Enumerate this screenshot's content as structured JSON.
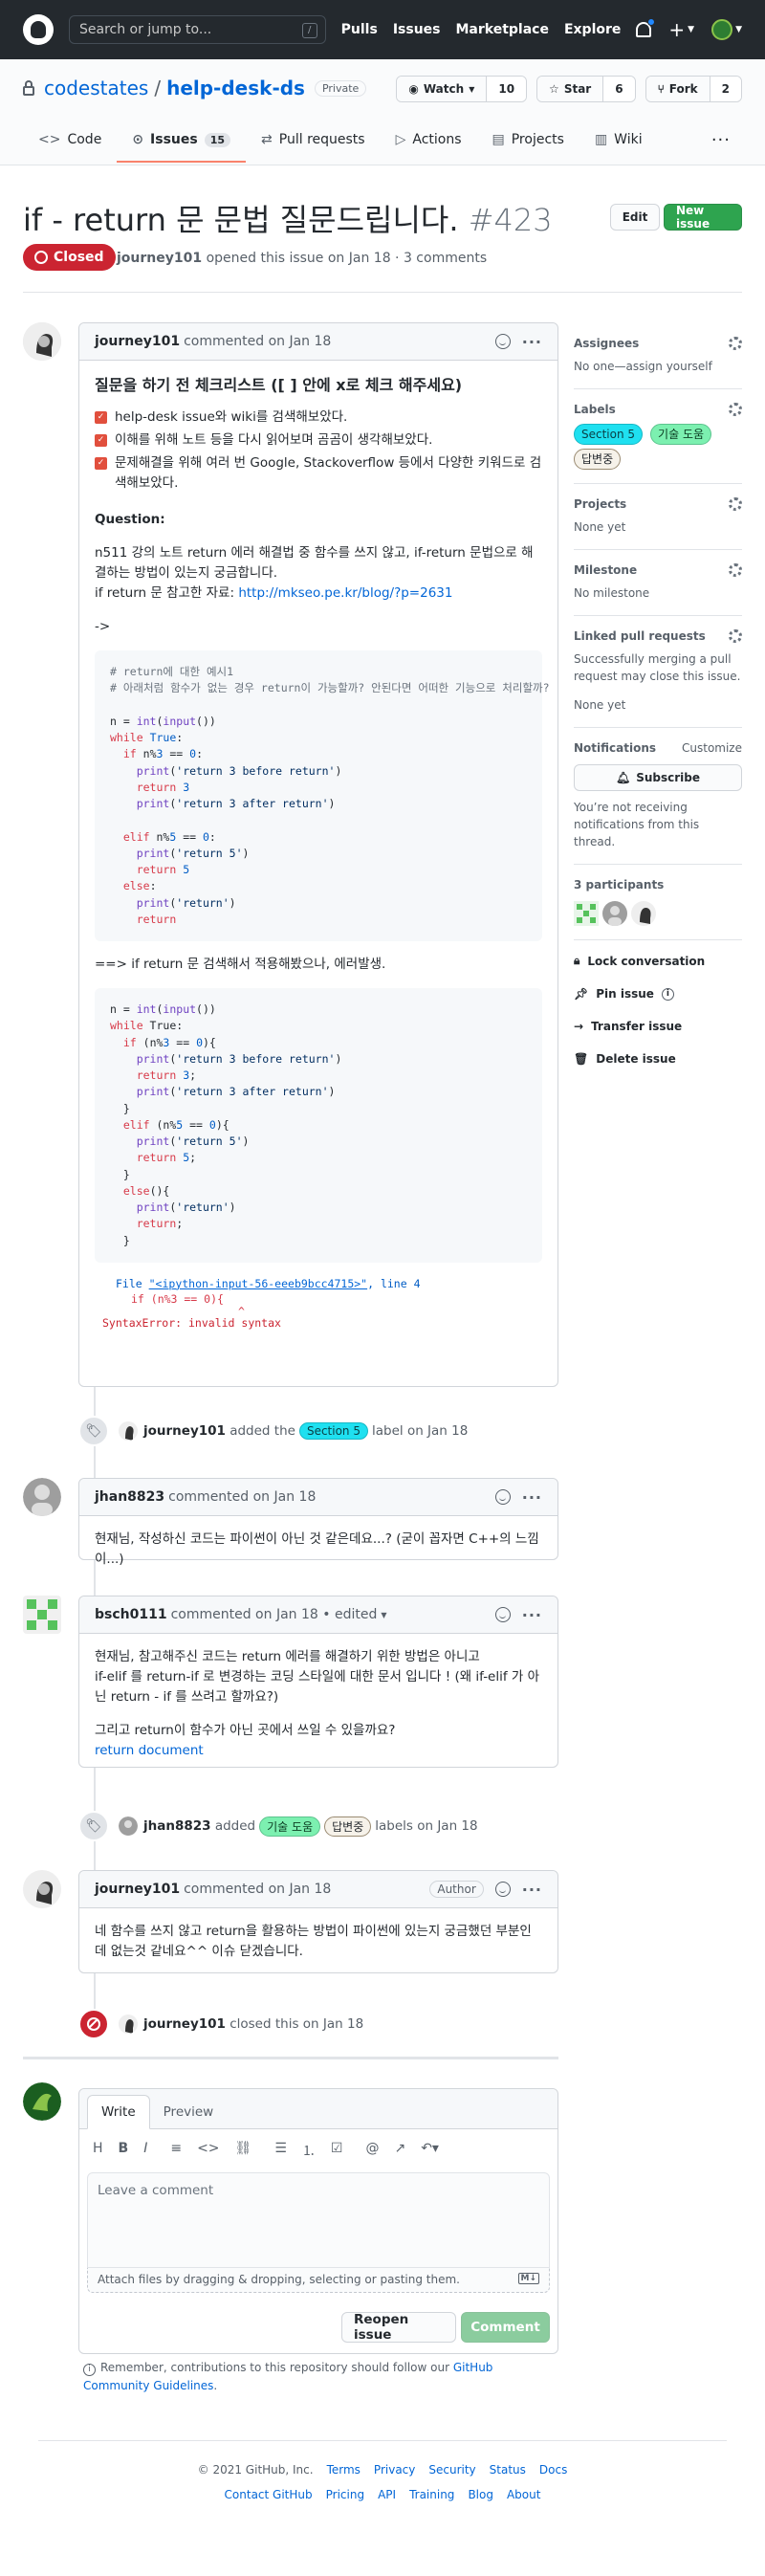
{
  "header": {
    "search_placeholder": "Search or jump to...",
    "slash": "/",
    "nav": [
      "Pulls",
      "Issues",
      "Marketplace",
      "Explore"
    ]
  },
  "repo": {
    "owner": "codestates",
    "sep": "/",
    "name": "help-desk-ds",
    "visibility": "Private",
    "watch_label": "Watch",
    "watch_count": "10",
    "star_label": "Star",
    "star_count": "6",
    "fork_label": "Fork",
    "fork_count": "2"
  },
  "tabs": [
    {
      "label": "Code"
    },
    {
      "label": "Issues",
      "count": "15"
    },
    {
      "label": "Pull requests"
    },
    {
      "label": "Actions"
    },
    {
      "label": "Projects"
    },
    {
      "label": "Wiki"
    }
  ],
  "issue": {
    "title": "if - return 문 문법 질문드립니다.",
    "number": "#423",
    "edit_label": "Edit",
    "new_issue_label": "New issue",
    "state": "Closed",
    "author": "journey101",
    "meta": "opened this issue on Jan 18 · 3 comments"
  },
  "c1": {
    "author": "journey101",
    "meta": "commented on Jan 18",
    "heading": "질문을 하기 전 체크리스트 ([ ] 안에 x로 체크 해주세요)",
    "checks": [
      "help-desk issue와 wiki를 검색해보았다.",
      "이해를 위해 노트 등을 다시 읽어보며 곰곰이 생각해보았다.",
      "문제해결을 위해 여러 번 Google, Stackoverflow 등에서 다양한 키워드로 검색해보았다."
    ],
    "question_label": "Question:",
    "question_text": "n511 강의 노트 return 에러 해결법 중 함수를 쓰지 않고, if-return 문법으로 해결하는 방법이 있는지 궁금합니다.",
    "ref_prefix": "if return 문 참고한 자료: ",
    "ref_link": "http://mkseo.pe.kr/blog/?p=2631",
    "arrow": "->",
    "mid_text": "==> if return 문 검색해서 적용해봤으나, 에러발생.",
    "tb_file": "\"<ipython-input-56-eeeb9bcc4715>\"",
    "tb_line": ", line 4",
    "tb_src": "if (n%3 == 0){",
    "tb_caret": "^",
    "tb_err": "SyntaxError: invalid syntax"
  },
  "ev1": {
    "author": "journey101",
    "pre": "added the",
    "label": "Section 5",
    "post": "label on Jan 18"
  },
  "c2": {
    "author": "jhan8823",
    "meta": "commented on Jan 18",
    "body": "현재님, 작성하신 코드는 파이썬이 아닌 것 같은데요...? (굳이 꼽자면 C++의 느낌이...)"
  },
  "c3": {
    "author": "bsch0111",
    "meta": "commented on Jan 18 • edited",
    "line1": "현재님, 참고해주신 코드는 return 에러를 해결하기 위한 방법은 아니고",
    "line2": "if-elif 를 return-if 로 변경하는 코딩 스타일에 대한 문서 입니다 ! (왜 if-elif 가 아닌 return - if 를 쓰려고 할까요?)",
    "line3": "그리고 return이 함수가 아닌 곳에서 쓰일 수 있을까요?",
    "link": "return document"
  },
  "ev2": {
    "author": "jhan8823",
    "pre": "added",
    "label1": "기술 도움",
    "label2": "답변중",
    "post": "labels on Jan 18"
  },
  "c4": {
    "author": "journey101",
    "meta": "commented on Jan 18",
    "badge": "Author",
    "body": "네 함수를 쓰지 않고 return을 활용하는 방법이 파이썬에 있는지 궁금했던 부분인데 없는것 같네요^^ 이슈 닫겠습니다."
  },
  "ev3": {
    "author": "journey101",
    "post": "closed this on Jan 18"
  },
  "editor": {
    "tab_write": "Write",
    "tab_preview": "Preview",
    "placeholder": "Leave a comment",
    "attach": "Attach files by dragging & dropping, selecting or pasting them.",
    "md": "M↓",
    "reopen": "Reopen issue",
    "comment": "Comment",
    "remember_pre": "Remember, contributions to this repository should follow our ",
    "remember_link": "GitHub Community Guidelines",
    "remember_post": "."
  },
  "sidebar": {
    "assignees_h": "Assignees",
    "assignees_v": "No one—assign yourself",
    "labels_h": "Labels",
    "labels": [
      "Section 5",
      "기술 도움",
      "답변중"
    ],
    "projects_h": "Projects",
    "projects_v": "None yet",
    "milestone_h": "Milestone",
    "milestone_v": "No milestone",
    "linked_h": "Linked pull requests",
    "linked_v": "Successfully merging a pull request may close this issue.",
    "linked_v2": "None yet",
    "notif_h": "Notifications",
    "customize": "Customize",
    "subscribe": "Subscribe",
    "notif_v": "You’re not receiving notifications from this thread.",
    "participants_h": "3 participants",
    "lock": "Lock conversation",
    "pin": "Pin issue",
    "transfer": "Transfer issue",
    "delete": "Delete issue"
  },
  "footer": {
    "copy": "© 2021 GitHub, Inc.",
    "row1": [
      "Terms",
      "Privacy",
      "Security",
      "Status",
      "Docs"
    ],
    "row2": [
      "Contact GitHub",
      "Pricing",
      "API",
      "Training",
      "Blog",
      "About"
    ]
  },
  "colors": {
    "closed": "#cb2431",
    "accent": "#2ea44f",
    "section5": "#1fe0f0",
    "help": "#7cf0b0",
    "answering": "#f6f2ea"
  }
}
